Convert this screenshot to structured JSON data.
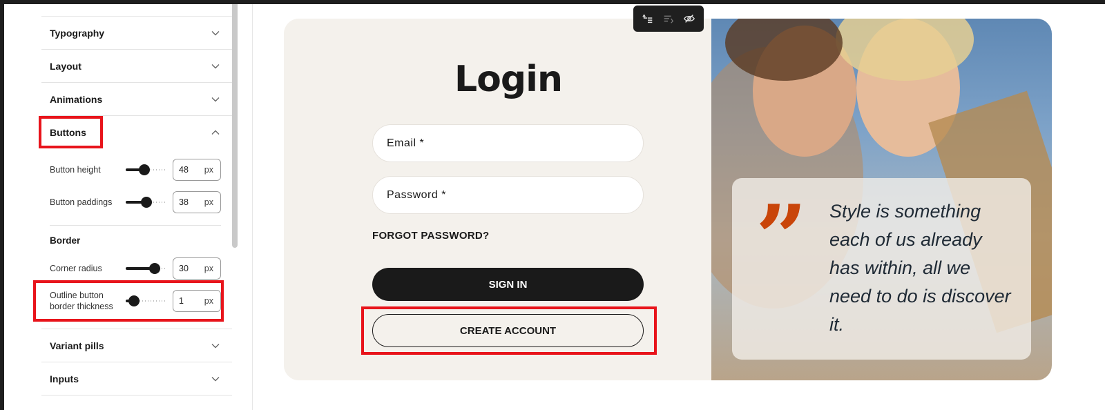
{
  "panel": {
    "sections_top": [
      {
        "label": "Typography"
      },
      {
        "label": "Layout"
      },
      {
        "label": "Animations"
      }
    ],
    "buttons_section": {
      "label": "Buttons",
      "controls": [
        {
          "label": "Button height",
          "value": "48",
          "unit": "px",
          "level": 0.45
        },
        {
          "label": "Button paddings",
          "value": "38",
          "unit": "px",
          "level": 0.5
        }
      ],
      "border_label": "Border",
      "border_controls": [
        {
          "label": "Corner radius",
          "value": "30",
          "unit": "px",
          "level": 0.7
        },
        {
          "label_line1": "Outline button",
          "label_line2": "border thickness",
          "value": "1",
          "unit": "px",
          "level": 0.05
        }
      ]
    },
    "sections_bottom": [
      {
        "label": "Variant pills"
      },
      {
        "label": "Inputs"
      }
    ]
  },
  "preview": {
    "title": "Login",
    "email_placeholder": "Email *",
    "password_placeholder": "Password *",
    "forgot_label": "FORGOT PASSWORD?",
    "signin_label": "SIGN IN",
    "create_account_label": "CREATE ACCOUNT",
    "quote_mark": "”",
    "quote_text": "Style is something each of us already has within, all we need to do is discover it."
  },
  "toolbar": {
    "icons": [
      "select-parent-icon",
      "move-icon",
      "hide-icon"
    ]
  },
  "colors": {
    "accent_highlight": "#e8141b",
    "primary_button": "#1a1a1a",
    "quote_mark": "#c9450a",
    "card_background": "#f4f1ec"
  }
}
